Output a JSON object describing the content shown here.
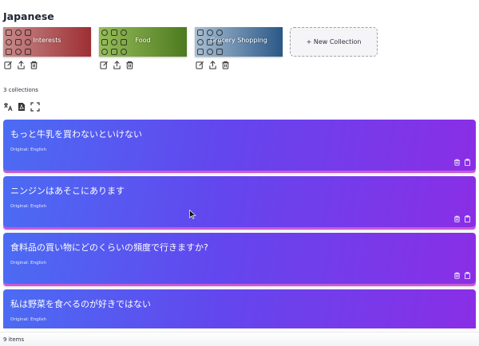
{
  "language_title": "Japanese",
  "collections": [
    {
      "label": "Interests",
      "colors": [
        "#c27a7c",
        "#a5383c"
      ]
    },
    {
      "label": "Food",
      "colors": [
        "#8bb34e",
        "#587f25"
      ]
    },
    {
      "label": "Grocery Shopping",
      "colors": [
        "#95b0c8",
        "#2e5a88"
      ]
    }
  ],
  "new_collection_label": "+ New Collection",
  "collections_count": "3 collections",
  "cards": [
    {
      "phrase": "もっと牛乳を買わないといけない",
      "original": "Original: English"
    },
    {
      "phrase": "ニンジンはあそこにあります",
      "original": "Original: English"
    },
    {
      "phrase": "食料品の買い物にどのくらいの頻度で行きますか?",
      "original": "Original: English"
    },
    {
      "phrase": "私は野菜を食べるのが好きではない",
      "original": "Original: English"
    }
  ],
  "items_count": "9 items",
  "icons": {
    "collection_actions": [
      "edit-icon",
      "share-icon",
      "trash-icon"
    ],
    "tools": [
      "translate-icon",
      "pdf-icon",
      "fullscreen-icon"
    ],
    "card_actions": [
      "trash-icon",
      "clipboard-icon"
    ]
  }
}
